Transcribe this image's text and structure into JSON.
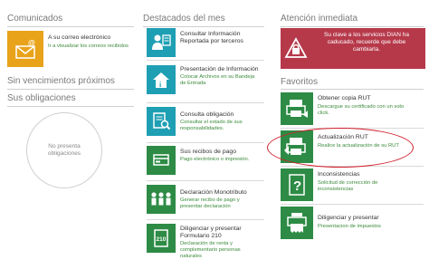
{
  "comunicados": {
    "title": "Comunicados",
    "card": {
      "icon": "mail-icon",
      "title": "A su correo electrónico",
      "subtitle": "Ir a visualizar los correos recibidos"
    }
  },
  "vencimientos": {
    "title": "Sin vencimientos próximos"
  },
  "obligaciones": {
    "title": "Sus obligaciones",
    "empty_text": "No presenta obligaciones"
  },
  "destacados": {
    "title": "Destacados del mes",
    "items": [
      {
        "icon": "consult-info-icon",
        "title": "Consultar Información Reportada por terceros",
        "subtitle": ""
      },
      {
        "icon": "house-info-icon",
        "title": "Presentación de Información",
        "subtitle": "Colocar Archivos en su Bandeja de Entrada"
      },
      {
        "icon": "document-search-icon",
        "title": "Consulta obligación",
        "subtitle": "Consultar el estado de sus responsabilidades."
      },
      {
        "icon": "receipt-icon",
        "title": "Sus recibos de pago",
        "subtitle": "Pago electrónico o impresión."
      },
      {
        "icon": "people-icon",
        "title": "Declaración Monotributo",
        "subtitle": "Generar recibo de pago y presentar declaración"
      },
      {
        "icon": "form-210-icon",
        "title": "Diligenciar y presentar Formulario 210",
        "subtitle": "Declaración de renta y complementario personas naturales"
      }
    ]
  },
  "atencion": {
    "title": "Atención inmediata",
    "alert_icon": "lock-warning-icon",
    "alert_text": "Su clave a los servicios DIAN ha caducado, recuerde que debe cambiarla."
  },
  "favoritos": {
    "title": "Favoritos",
    "items": [
      {
        "icon": "rut-copy-icon",
        "title": "Obtener copia RUT",
        "subtitle": "Descargue su certificado con un solo click."
      },
      {
        "icon": "rut-update-icon",
        "title": "Actualización RUT",
        "subtitle": "Realice la actualización de su RUT"
      },
      {
        "icon": "inconsistency-icon",
        "title": "Inconsistencias",
        "subtitle": "Solicitud de corrección de inconsistencias"
      },
      {
        "icon": "diligence-icon",
        "title": "Diligenciar y presentar",
        "subtitle": "Presentacion de impuestos"
      }
    ]
  },
  "colors": {
    "teal": "#1f9fb3",
    "green": "#2d8b45",
    "red": "#b6394a",
    "orange": "#e8a31b",
    "annotation": "#d21e2a"
  }
}
